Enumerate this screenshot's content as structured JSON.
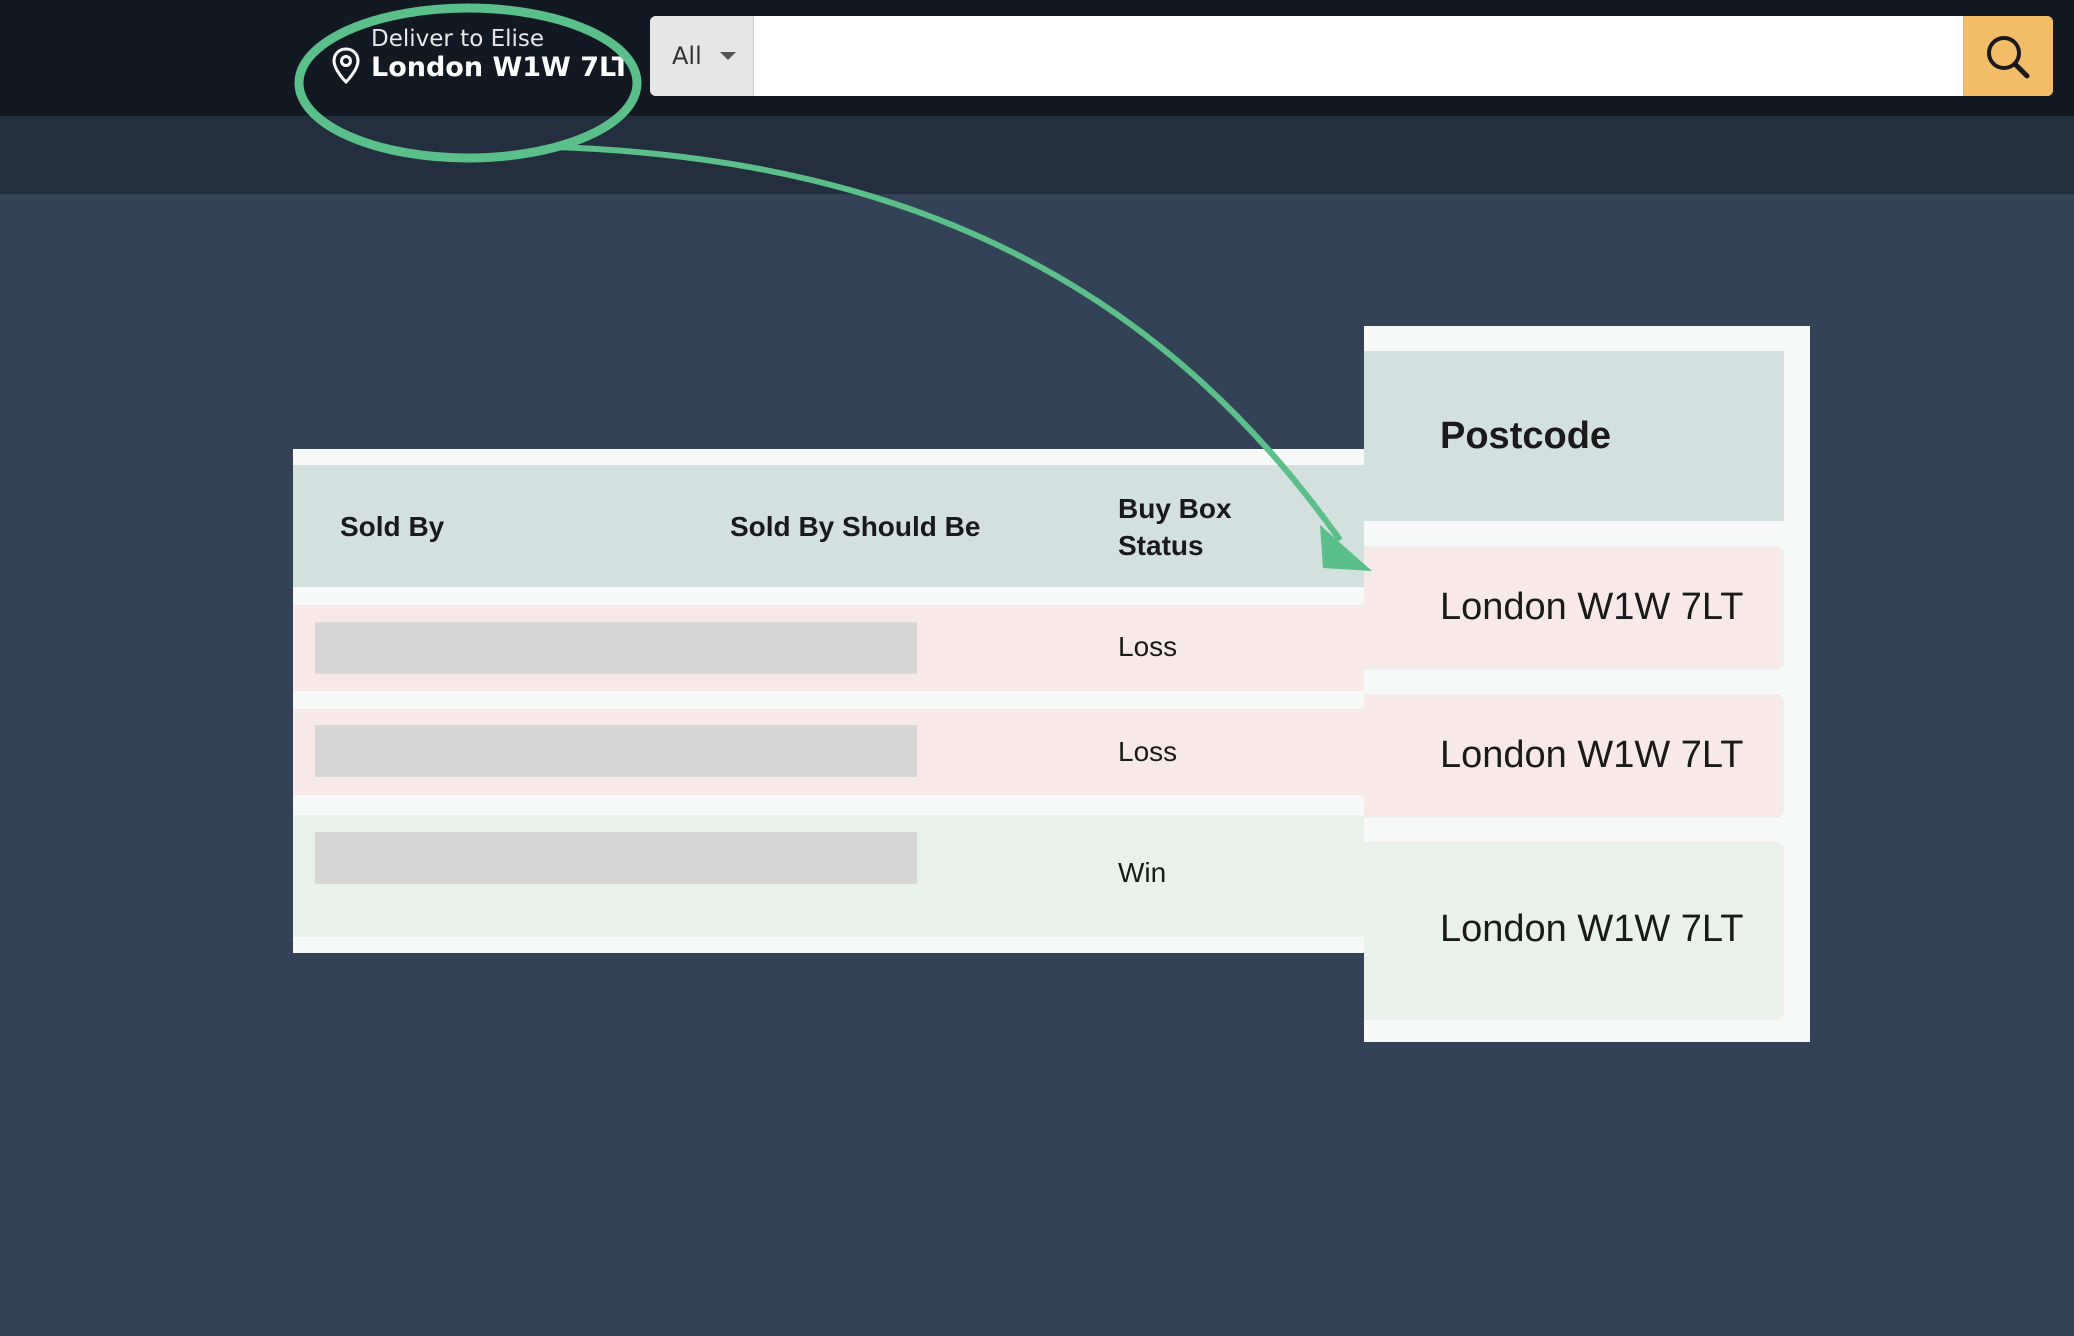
{
  "header": {
    "deliver_label": "Deliver to Elise",
    "deliver_location": "London W1W 7LT",
    "search": {
      "category": "All",
      "query": "",
      "placeholder": ""
    },
    "icons": {
      "location": "location-pin-icon",
      "search": "search-icon",
      "caret": "chevron-down-icon"
    }
  },
  "table": {
    "columns": [
      "Sold By",
      "Sold By Should Be",
      "Buy Box",
      "Status"
    ],
    "rows": [
      {
        "sold_by": "",
        "sold_by_should_be": "",
        "status": "Loss"
      },
      {
        "sold_by": "",
        "sold_by_should_be": "",
        "status": "Loss"
      },
      {
        "sold_by": "",
        "sold_by_should_be": "",
        "status": "Win"
      }
    ]
  },
  "postcode": {
    "header": "Postcode",
    "values": [
      "London W1W 7LT",
      "London W1W 7LT",
      "London W1W 7LT"
    ]
  },
  "colors": {
    "annotation": "#5bbf8a",
    "search_button": "#f3bd68",
    "loss_row": "#f7e9e8",
    "win_row": "#e8f2ea",
    "table_header": "#d2e1de"
  }
}
